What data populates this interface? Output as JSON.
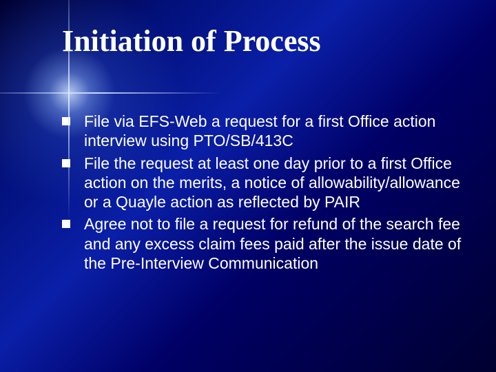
{
  "slide": {
    "title": "Initiation of Process",
    "bullets": [
      {
        "text": "File via EFS-Web a request for a first Office action interview using PTO/SB/413C"
      },
      {
        "text": "File the request at least one day prior to a first Office action on the merits, a notice of allowability/allowance or a Quayle action as reflected by PAIR"
      },
      {
        "text": "Agree not to file a request for refund of the search fee and any excess claim fees paid after the issue date of the Pre-Interview Communication"
      }
    ]
  }
}
